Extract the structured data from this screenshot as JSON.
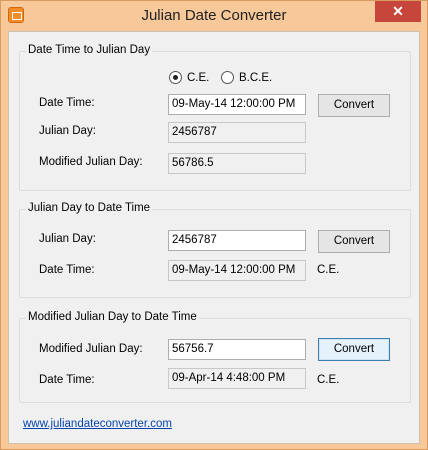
{
  "window": {
    "title": "Julian Date Converter",
    "close_glyph": "✕"
  },
  "section1": {
    "legend": "Date Time to Julian Day",
    "radio_ce": "C.E.",
    "radio_bce": "B.C.E.",
    "selected_era": "C.E.",
    "datetime_label": "Date Time:",
    "datetime_value": "09-May-14 12:00:00 PM",
    "convert_label": "Convert",
    "julian_label": "Julian Day:",
    "julian_value": "2456787",
    "mjd_label": "Modified Julian Day:",
    "mjd_value": "56786.5"
  },
  "section2": {
    "legend": "Julian Day to Date Time",
    "julian_label": "Julian Day:",
    "julian_value": "2456787",
    "convert_label": "Convert",
    "datetime_label": "Date Time:",
    "datetime_value": "09-May-14 12:00:00 PM",
    "era": "C.E."
  },
  "section3": {
    "legend": "Modified Julian Day to Date Time",
    "mjd_label": "Modified Julian Day:",
    "mjd_value": "56756.7",
    "convert_label": "Convert",
    "datetime_label": "Date Time:",
    "datetime_value": "09-Apr-14 4:48:00 PM",
    "era": "C.E."
  },
  "footer": {
    "link": "www.juliandateconverter.com"
  },
  "icons": {
    "app": "app-icon",
    "close": "close-icon"
  }
}
